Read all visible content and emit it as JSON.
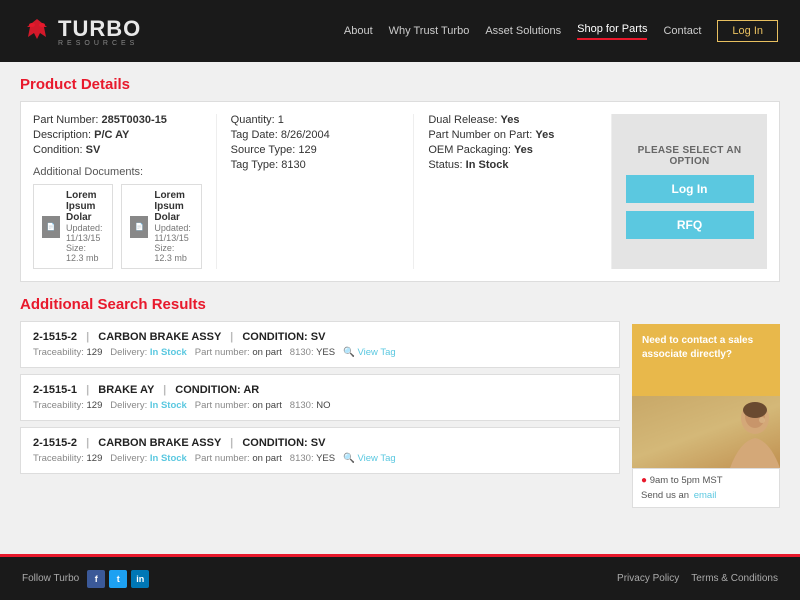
{
  "header": {
    "logo_turbo": "TURBO",
    "logo_resources": "RESOURCES",
    "nav_items": [
      {
        "label": "About",
        "active": false
      },
      {
        "label": "Why Trust Turbo",
        "active": false
      },
      {
        "label": "Asset Solutions",
        "active": false
      },
      {
        "label": "Shop for Parts",
        "active": true
      },
      {
        "label": "Contact",
        "active": false
      }
    ],
    "login_label": "Log In"
  },
  "product_details": {
    "section_title": "Product Details",
    "part_number_label": "Part Number:",
    "part_number_value": "285T0030-15",
    "description_label": "Description:",
    "description_value": "P/C AY",
    "condition_label": "Condition:",
    "condition_value": "SV",
    "quantity_label": "Quantity:",
    "quantity_value": "1",
    "tag_date_label": "Tag Date:",
    "tag_date_value": "8/26/2004",
    "source_type_label": "Source Type:",
    "source_type_value": "129",
    "tag_type_label": "Tag Type:",
    "tag_type_value": "8130",
    "dual_release_label": "Dual Release:",
    "dual_release_value": "Yes",
    "part_number_on_part_label": "Part Number on Part:",
    "part_number_on_part_value": "Yes",
    "oem_packaging_label": "OEM Packaging:",
    "oem_packaging_value": "Yes",
    "status_label": "Status:",
    "status_value": "In Stock",
    "additional_docs_label": "Additional Documents:",
    "doc1_name": "Lorem Ipsum Dolar",
    "doc1_meta": "Updated: 11/13/15 Size: 12.3 mb",
    "doc2_name": "Lorem Ipsum Dolar",
    "doc2_meta": "Updated: 11/13/15 Size: 12.3 mb"
  },
  "select_panel": {
    "title": "PLEASE SELECT AN OPTION",
    "login_label": "Log In",
    "rfq_label": "RFQ"
  },
  "additional_search": {
    "section_title": "Additional Search Results",
    "results": [
      {
        "part": "2-1515-2",
        "name": "CARBON BRAKE ASSY",
        "condition": "CONDITION: SV",
        "traceability": "129",
        "delivery": "In Stock",
        "part_number_on_part": "on part",
        "tag_type": "8130",
        "yes_no": "YES",
        "has_view_tag": true
      },
      {
        "part": "2-1515-1",
        "name": "BRAKE AY",
        "condition": "CONDITION: AR",
        "traceability": "129",
        "delivery": "In Stock",
        "part_number_on_part": "on part",
        "tag_type": "8130",
        "yes_no": "NO",
        "has_view_tag": false
      },
      {
        "part": "2-1515-2",
        "name": "CARBON BRAKE ASSY",
        "condition": "CONDITION: SV",
        "traceability": "129",
        "delivery": "In Stock",
        "part_number_on_part": "on part",
        "tag_type": "8130",
        "yes_no": "YES",
        "has_view_tag": true
      }
    ]
  },
  "contact_panel": {
    "message": "Need to contact a sales associate directly?",
    "hours": "9am to 5pm MST",
    "send_us": "Send us an",
    "email_link": "email"
  },
  "footer": {
    "follow_text": "Follow Turbo",
    "links": [
      {
        "label": "Privacy Policy"
      },
      {
        "label": "Terms & Conditions"
      }
    ]
  }
}
